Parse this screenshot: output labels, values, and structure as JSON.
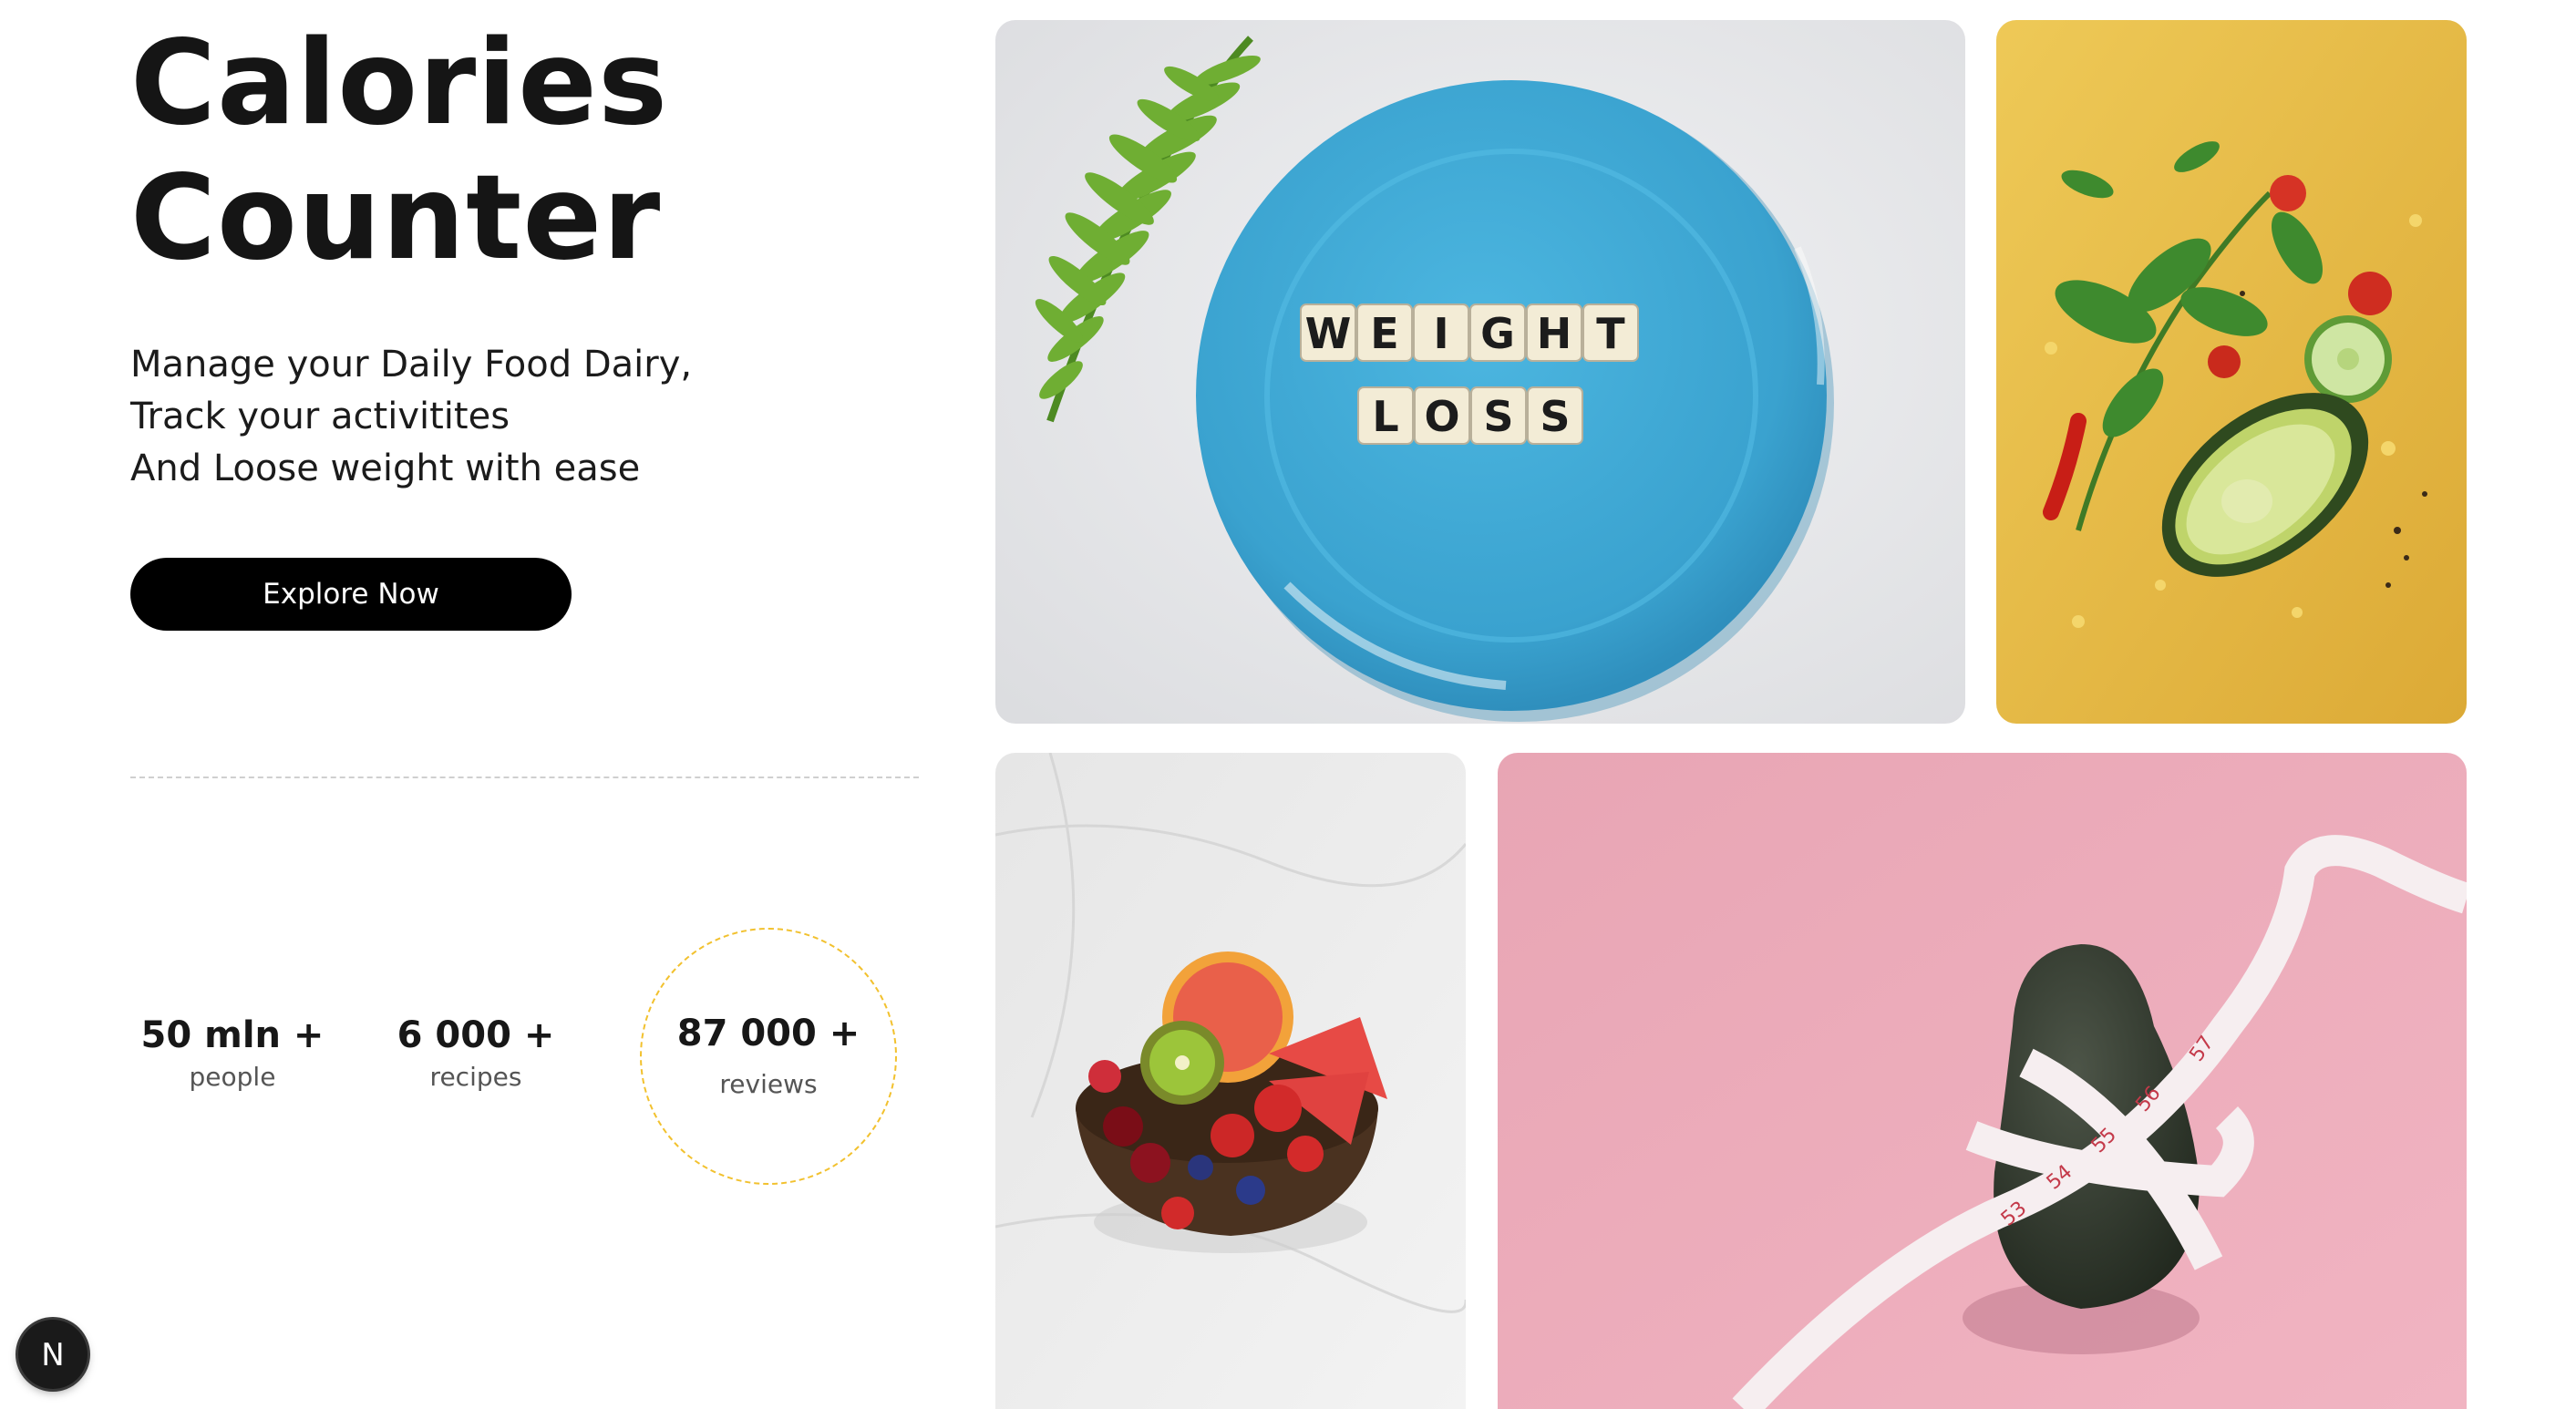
{
  "hero": {
    "title_line1": "Calories",
    "title_line2": "Counter",
    "subtitle_lines": [
      "Manage your Daily Food Dairy,",
      "Track your activitites",
      "And Loose weight with ease"
    ],
    "cta_label": "Explore Now"
  },
  "stats": [
    {
      "value": "50 mln +",
      "label": "people"
    },
    {
      "value": "6 000 +",
      "label": "recipes"
    },
    {
      "value": "87 000 +",
      "label": "reviews"
    }
  ],
  "gallery": {
    "plate_tiles_line1": [
      "W",
      "E",
      "I",
      "G",
      "H",
      "T"
    ],
    "plate_tiles_line2": [
      "L",
      "O",
      "S",
      "S"
    ],
    "tape_numbers": [
      "53",
      "54",
      "55",
      "56",
      "57"
    ]
  },
  "badge": {
    "letter": "N"
  },
  "colors": {
    "accent_ring": "#f2c12e",
    "button_bg": "#000000",
    "plate_blue": "#3fa9d6",
    "veg_background": "#e6b93e",
    "avocado_background": "#eba9b8"
  },
  "icons": [
    "fern-icon",
    "basil-icon",
    "avocado-icon",
    "tape-measure-icon"
  ]
}
